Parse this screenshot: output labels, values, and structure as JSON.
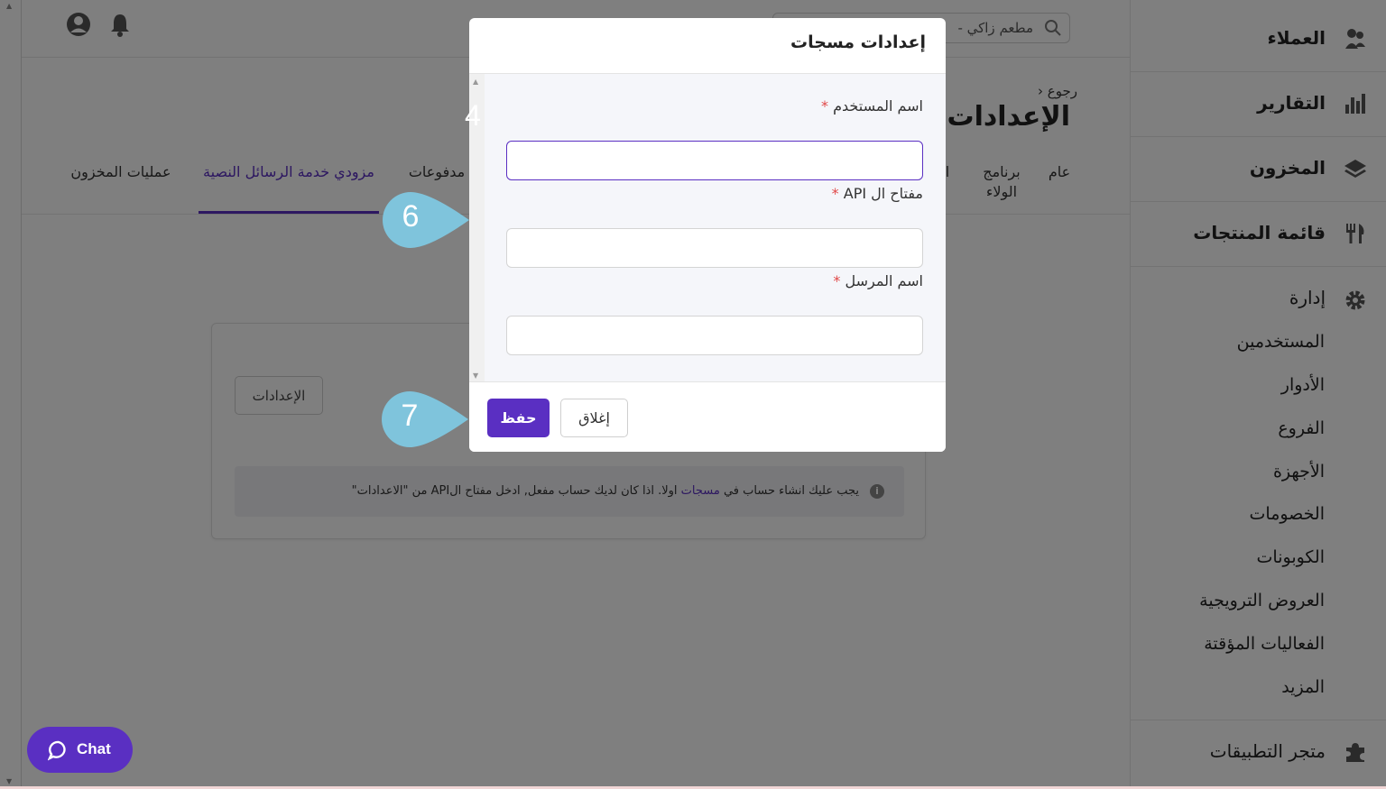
{
  "header": {
    "search_text": "مطعم زاكي -"
  },
  "page": {
    "back_label": "رجوع",
    "title": "الإعدادات"
  },
  "tabs": [
    {
      "label": "عام"
    },
    {
      "label": "برنامج الولاء"
    },
    {
      "label": "ا"
    },
    {
      "label": "مدفوعات"
    },
    {
      "label": "مزودي خدمة الرسائل النصية",
      "active": true
    },
    {
      "label": "عمليات المخزون"
    }
  ],
  "card": {
    "settings_button": "الإعدادات",
    "info_text_before": "يجب عليك انشاء حساب في",
    "info_link": "مسجات",
    "info_text_after": "اولا. اذا كان لديك حساب مفعل, ادخل مفتاح الAPI من \"الاعدادات\""
  },
  "sidebar": {
    "top_items": [
      {
        "label": "العملاء",
        "icon": "customers-icon"
      },
      {
        "label": "التقارير",
        "icon": "reports-icon"
      },
      {
        "label": "المخزون",
        "icon": "inventory-icon"
      },
      {
        "label": "قائمة المنتجات",
        "icon": "menu-icon"
      }
    ],
    "management": {
      "label": "إدارة",
      "icon": "gear-icon",
      "sub_items": [
        "المستخدمين",
        "الأدوار",
        "الفروع",
        "الأجهزة",
        "الخصومات",
        "الكوبونات",
        "العروض الترويجية",
        "الفعاليات المؤقتة",
        "المزيد"
      ]
    },
    "app_store": {
      "label": "متجر التطبيقات",
      "icon": "puzzle-icon"
    }
  },
  "modal": {
    "title": "إعدادات مسجات",
    "fields": [
      {
        "label": "اسم المستخدم",
        "value": "",
        "required": "*"
      },
      {
        "label": "مفتاح ال API",
        "value": "",
        "required": "*"
      },
      {
        "label": "اسم المرسل",
        "value": "",
        "required": "*"
      }
    ],
    "save_label": "حفظ",
    "close_label": "إغلاق"
  },
  "markers": {
    "step4": "4",
    "step6": "6",
    "step7": "7",
    "color": "#7fc4dc"
  },
  "chat": {
    "label": "Chat"
  },
  "colors": {
    "accent": "#5a2fc2",
    "required": "#e04848"
  }
}
